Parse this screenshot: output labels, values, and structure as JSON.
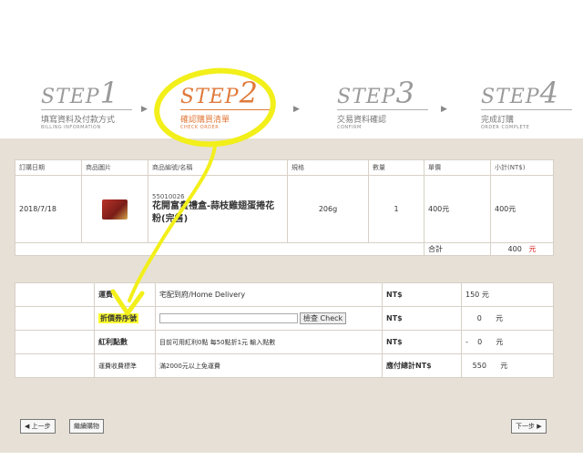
{
  "steps": [
    {
      "word": "STEP",
      "num": "1",
      "zh": "填寫資料及付款方式",
      "en": "BILLING INFORMATION"
    },
    {
      "word": "STEP",
      "num": "2",
      "zh": "確認購買清單",
      "en": "CHECK ORDER"
    },
    {
      "word": "STEP",
      "num": "3",
      "zh": "交易資料確認",
      "en": "CONFIRM"
    },
    {
      "word": "STEP",
      "num": "4",
      "zh": "完成訂購",
      "en": "ORDER COMPLETE"
    }
  ],
  "arrow_glyph": "▶",
  "order_table": {
    "headers": [
      "訂購日期",
      "商品圖片",
      "商品編號/名稱",
      "規格",
      "數量",
      "單價",
      "小計(NT$)"
    ],
    "row": {
      "date": "2018/7/18",
      "code": "55010026",
      "name": "花開富貴禮盒-蒜枝雞翅蛋捲花粉(完售)",
      "spec": "206g",
      "qty": "1",
      "price": "400元",
      "subtotal": "400元"
    },
    "total_label": "合計",
    "total_value": "400",
    "total_unit": "元"
  },
  "summary_table": {
    "shipping": {
      "label": "運費",
      "value": "宅配到府/Home Delivery",
      "cur": "NT$",
      "amount": "150 元"
    },
    "coupon": {
      "label": "折價券序號",
      "button": "檢查 Check",
      "cur": "NT$",
      "amount": "0",
      "unit": "元"
    },
    "bonus": {
      "label": "紅利點數",
      "value": "目前可用紅利0點    每50點折1元    輸入點數",
      "cur": "NT$",
      "sign": "-",
      "amount": "0",
      "unit": "元"
    },
    "info": {
      "label": "運費收費標準",
      "value": "滿2000元以上免運費",
      "cur": "應付總計NT$",
      "amount": "550",
      "unit": "元"
    }
  },
  "buttons": {
    "prev": "◀ 上一步",
    "continue": "繼續購物",
    "next": "下一步 ▶"
  },
  "colors": {
    "active": "#e07a3b",
    "highlight": "#ffff33",
    "panel": "#e7e0d6"
  }
}
